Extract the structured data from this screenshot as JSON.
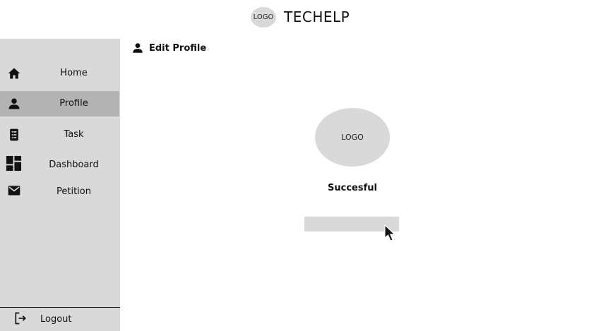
{
  "header": {
    "logo_text": "LOGO",
    "app_title": "TECHELP"
  },
  "sidebar": {
    "items": [
      {
        "label": "Home",
        "icon": "home-icon"
      },
      {
        "label": "Profile",
        "icon": "person-icon",
        "active": true
      },
      {
        "label": "Task",
        "icon": "task-list-icon"
      },
      {
        "label": "Dashboard",
        "icon": "dashboard-icon"
      },
      {
        "label": "Petition",
        "icon": "mail-icon"
      }
    ],
    "logout_label": "Logout"
  },
  "main": {
    "heading": "Edit Profile",
    "avatar_text": "LOGO",
    "status_text": "Succesful"
  },
  "colors": {
    "sidebar_bg": "#d9d9d9",
    "active_item_bg": "#b3b3b3",
    "placeholder_gray": "#d9d9d9"
  }
}
